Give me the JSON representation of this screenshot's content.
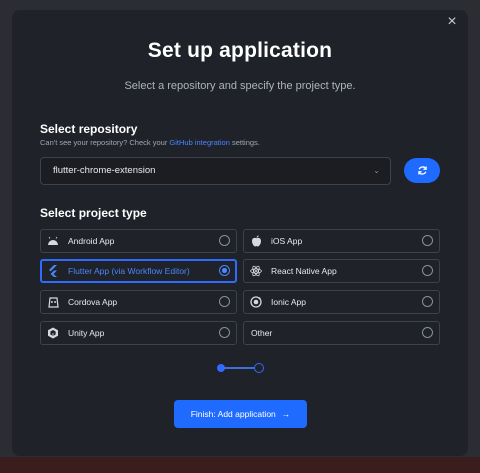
{
  "dialog": {
    "close_label": "×",
    "title": "Set up application",
    "subtitle": "Select a repository and specify the project type."
  },
  "repository": {
    "heading": "Select repository",
    "hint_prefix": "Can't see your repository? Check your ",
    "hint_link": "GitHub integration",
    "hint_suffix": " settings.",
    "selected_value": "flutter-chrome-extension",
    "caret": "⌄"
  },
  "project_type": {
    "heading": "Select project type",
    "options": [
      {
        "label": "Android App",
        "icon": "android-icon",
        "selected": false
      },
      {
        "label": "iOS App",
        "icon": "apple-icon",
        "selected": false
      },
      {
        "label": "Flutter App (via Workflow Editor)",
        "icon": "flutter-icon",
        "selected": true
      },
      {
        "label": "React Native App",
        "icon": "react-icon",
        "selected": false
      },
      {
        "label": "Cordova App",
        "icon": "cordova-icon",
        "selected": false
      },
      {
        "label": "Ionic App",
        "icon": "ionic-icon",
        "selected": false
      },
      {
        "label": "Unity App",
        "icon": "unity-icon",
        "selected": false
      },
      {
        "label": "Other",
        "icon": "",
        "selected": false
      }
    ]
  },
  "stepper": {
    "current_step": 1,
    "total_steps": 2
  },
  "footer": {
    "finish_label": "Finish: Add application",
    "arrow": "→"
  },
  "colors": {
    "accent": "#1f6bff",
    "modal_bg": "#1f2229",
    "border": "#3e424c"
  }
}
